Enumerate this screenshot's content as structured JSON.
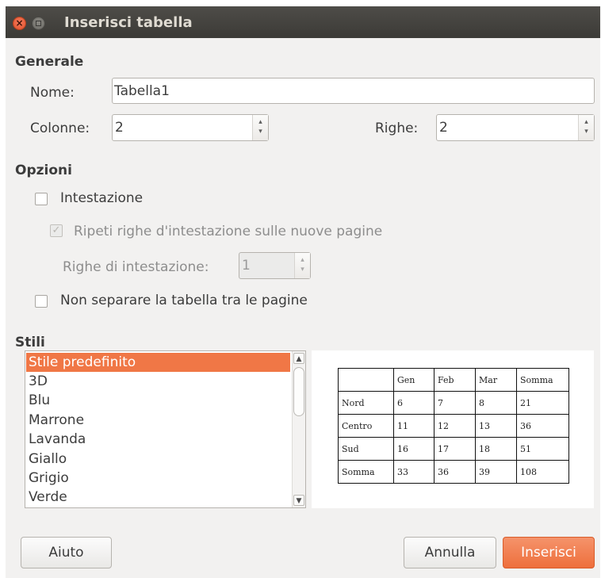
{
  "window": {
    "title": "Inserisci tabella",
    "close_glyph": "×"
  },
  "generale": {
    "heading": "Generale",
    "nome_label": "Nome:",
    "nome_value": "Tabella1",
    "colonne_label": "Colonne:",
    "colonne_value": "2",
    "righe_label": "Righe:",
    "righe_value": "2"
  },
  "opzioni": {
    "heading": "Opzioni",
    "intestazione_label": "Intestazione",
    "intestazione_checked": false,
    "ripeti_label": "Ripeti righe d'intestazione sulle nuove pagine",
    "ripeti_checked": true,
    "ripeti_enabled": false,
    "righe_intestazione_label": "Righe di intestazione:",
    "righe_intestazione_value": "1",
    "non_separare_label": "Non separare la tabella tra le pagine",
    "non_separare_checked": false
  },
  "stili": {
    "heading": "Stili",
    "items": [
      "Stile predefinito",
      "3D",
      "Blu",
      "Marrone",
      "Lavanda",
      "Giallo",
      "Grigio",
      "Verde"
    ],
    "selected": "Stile predefinito"
  },
  "preview": {
    "header": [
      "",
      "Gen",
      "Feb",
      "Mar",
      "Somma"
    ],
    "rows": [
      [
        "Nord",
        "6",
        "7",
        "8",
        "21"
      ],
      [
        "Centro",
        "11",
        "12",
        "13",
        "36"
      ],
      [
        "Sud",
        "16",
        "17",
        "18",
        "51"
      ],
      [
        "Somma",
        "33",
        "36",
        "39",
        "108"
      ]
    ]
  },
  "buttons": {
    "aiuto": "Aiuto",
    "annulla": "Annulla",
    "inserisci": "Inserisci"
  },
  "icons": {
    "spin_up": "▴",
    "spin_down": "▾",
    "scroll_up": "▲",
    "scroll_down": "▼",
    "check": "✓"
  },
  "colors": {
    "accent": "#f07746",
    "titlebar": "#3c3b37"
  }
}
